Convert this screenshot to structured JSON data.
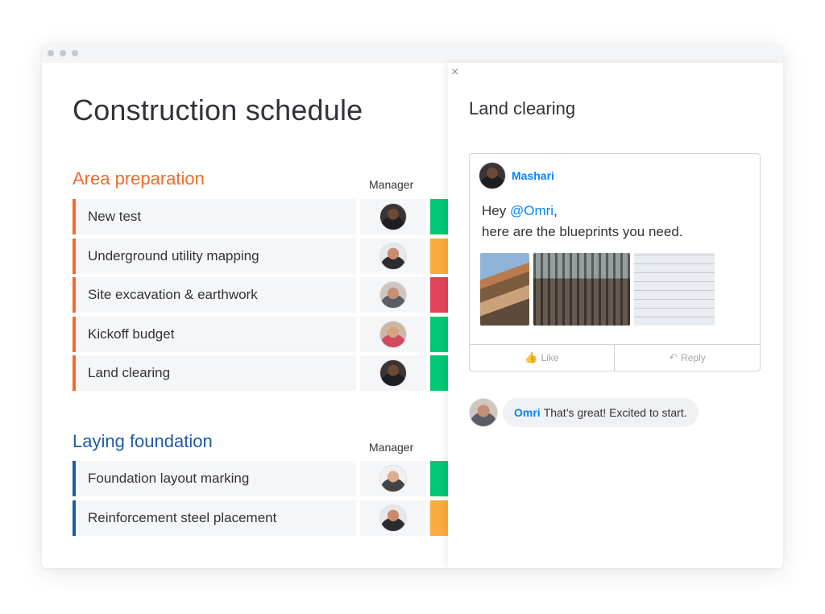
{
  "board": {
    "title": "Construction schedule",
    "groups": [
      {
        "title": "Area preparation",
        "color": "#f26b2a",
        "column_header": "Manager",
        "rows": [
          {
            "name": "New test",
            "status_color": "#00c875"
          },
          {
            "name": "Underground utility mapping",
            "status_color": "#fdab3d"
          },
          {
            "name": "Site excavation & earthwork",
            "status_color": "#e2445c"
          },
          {
            "name": "Kickoff budget",
            "status_color": "#00c875"
          },
          {
            "name": "Land clearing",
            "status_color": "#00c875"
          }
        ]
      },
      {
        "title": "Laying foundation",
        "color": "#1f5aa6",
        "column_header": "Manager",
        "rows": [
          {
            "name": "Foundation layout marking",
            "status_color": "#00c875"
          },
          {
            "name": "Reinforcement steel placement",
            "status_color": "#fdab3d"
          }
        ]
      }
    ]
  },
  "panel": {
    "close_icon": "×",
    "title": "Land clearing",
    "update": {
      "author": "Mashari",
      "greeting": "Hey ",
      "mention": "@Omri",
      "greeting_end": ",",
      "line2": "here are the blueprints you need.",
      "like_label": "Like",
      "reply_label": "Reply",
      "like_icon": "👍",
      "reply_icon": "↶"
    },
    "reply": {
      "author": "Omri",
      "text": "That’s great! Excited to start."
    }
  },
  "colors": {
    "accent_link": "#0085ff",
    "status_green": "#00c875",
    "status_orange": "#fdab3d",
    "status_red": "#e2445c"
  }
}
